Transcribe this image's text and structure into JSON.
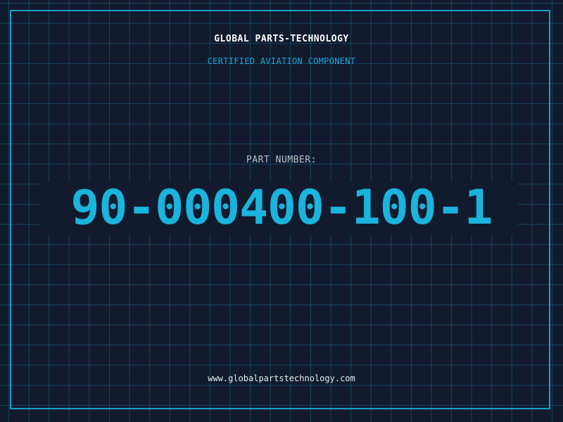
{
  "header": {
    "company": "GLOBAL PARTS-TECHNOLOGY",
    "subtitle": "CERTIFIED AVIATION COMPONENT"
  },
  "part": {
    "label": "PART NUMBER:",
    "number": "90-000400-100-1"
  },
  "footer": {
    "website": "www.globalpartstechnology.com"
  },
  "colors": {
    "background": "#121a2e",
    "grid": "#147896",
    "frame": "#1a9fc4",
    "accent": "#1ab4dc",
    "text": "#ffffff"
  }
}
